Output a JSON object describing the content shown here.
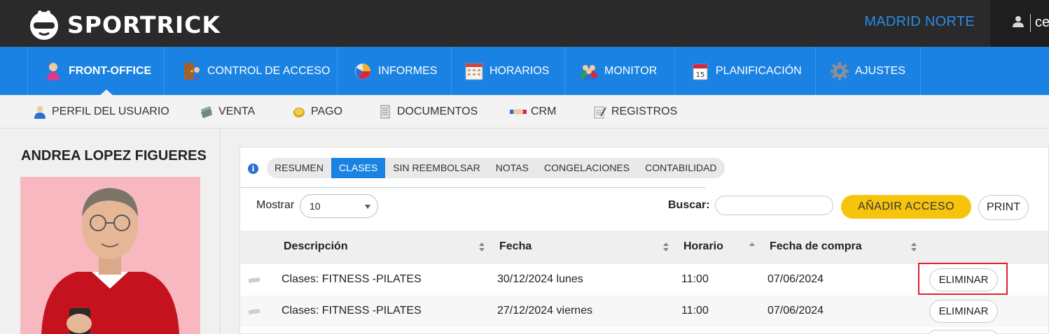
{
  "brand": {
    "name": "SPORTRICK",
    "logo_icon": "sportrick-mascot-logo"
  },
  "header": {
    "location": "MADRID NORTE",
    "user_icon": "user-icon",
    "user_name": "ce"
  },
  "main_nav": [
    {
      "label": "FRONT-OFFICE",
      "icon": "front-office-person-icon",
      "active": true
    },
    {
      "label": "CONTROL DE ACCESO",
      "icon": "door-access-icon",
      "active": false
    },
    {
      "label": "INFORMES",
      "icon": "pie-chart-icon",
      "active": false
    },
    {
      "label": "HORARIOS",
      "icon": "calendar-grid-icon",
      "active": false
    },
    {
      "label": "MONITOR",
      "icon": "people-group-icon",
      "active": false
    },
    {
      "label": "PLANIFICACIÓN",
      "icon": "calendar-15-icon",
      "active": false
    },
    {
      "label": "AJUSTES",
      "icon": "gear-icon",
      "active": false
    }
  ],
  "sub_nav": [
    {
      "label": "PERFIL DEL USUARIO",
      "icon": "user-profile-icon"
    },
    {
      "label": "VENTA",
      "icon": "cash-icon"
    },
    {
      "label": "PAGO",
      "icon": "coins-icon"
    },
    {
      "label": "DOCUMENTOS",
      "icon": "document-icon"
    },
    {
      "label": "CRM",
      "icon": "handshake-icon"
    },
    {
      "label": "REGISTROS",
      "icon": "notepad-icon"
    }
  ],
  "profile": {
    "name": "ANDREA LOPEZ FIGUERES"
  },
  "tabs": [
    {
      "label": "RESUMEN",
      "active": false
    },
    {
      "label": "CLASES",
      "active": true
    },
    {
      "label": "SIN REEMBOLSAR",
      "active": false
    },
    {
      "label": "NOTAS",
      "active": false
    },
    {
      "label": "CONGELACIONES",
      "active": false
    },
    {
      "label": "CONTABILIDAD",
      "active": false
    }
  ],
  "controls": {
    "show_label": "Mostrar",
    "show_value": "10",
    "search_label": "Buscar:",
    "search_value": "",
    "add_button": "AÑADIR ACCESO",
    "print_button": "PRINT"
  },
  "table": {
    "columns": [
      "Descripción",
      "Fecha",
      "Horario",
      "Fecha de compra"
    ],
    "rows": [
      {
        "descripcion": "Clases: FITNESS -PILATES",
        "fecha": "30/12/2024 lunes",
        "horario": "11:00",
        "fecha_compra": "07/06/2024",
        "action": "ELIMINAR"
      },
      {
        "descripcion": "Clases: FITNESS -PILATES",
        "fecha": "27/12/2024 viernes",
        "horario": "11:00",
        "fecha_compra": "07/06/2024",
        "action": "ELIMINAR"
      }
    ]
  },
  "colors": {
    "topbar": "#2a2a2a",
    "nav_blue": "#1a82e2",
    "location_blue": "#2b8be8",
    "add_button_yellow": "#f6c40c",
    "highlight_red": "#e0202c"
  }
}
